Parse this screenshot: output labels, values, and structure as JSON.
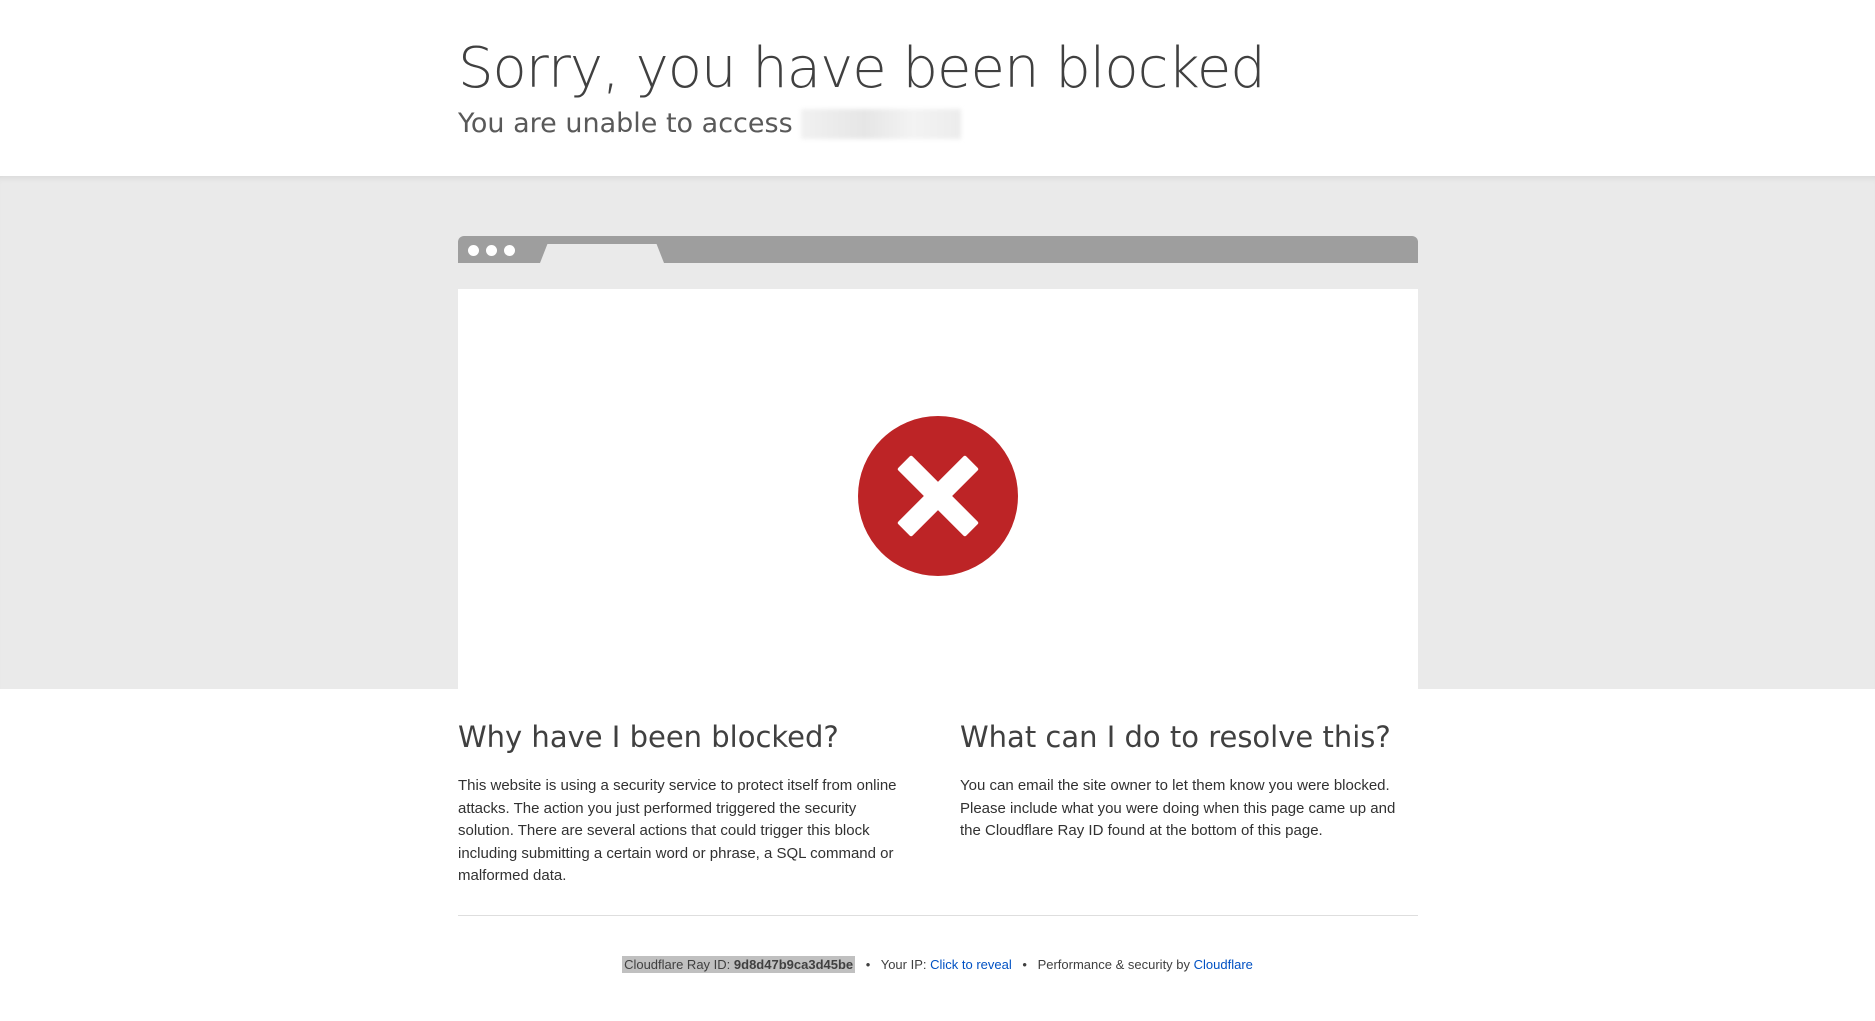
{
  "header": {
    "title": "Sorry, you have been blocked",
    "subtitle": "You are unable to access"
  },
  "sections": {
    "why": {
      "heading": "Why have I been blocked?",
      "body": "This website is using a security service to protect itself from online attacks. The action you just performed triggered the security solution. There are several actions that could trigger this block including submitting a certain word or phrase, a SQL command or malformed data."
    },
    "resolve": {
      "heading": "What can I do to resolve this?",
      "body": "You can email the site owner to let them know you were blocked. Please include what you were doing when this page came up and the Cloudflare Ray ID found at the bottom of this page."
    }
  },
  "footer": {
    "ray_label": "Cloudflare Ray ID:",
    "ray_id": "9d8d47b9ca3d45be",
    "separator": "•",
    "ip_label": "Your IP:",
    "ip_link": "Click to reveal",
    "perf_label": "Performance & security by",
    "cloudflare_link": "Cloudflare"
  },
  "icons": {
    "error": "error-x-circle-icon"
  },
  "colors": {
    "error_red": "#bd2426",
    "link_blue": "#0051c3",
    "band_gray": "#eaeaea",
    "browser_bar": "#9e9e9e"
  }
}
